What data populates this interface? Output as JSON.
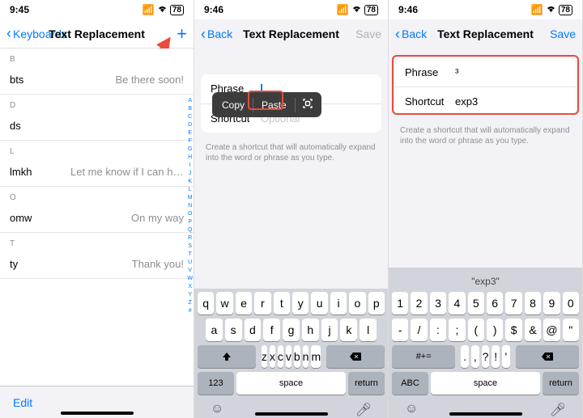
{
  "p1": {
    "time": "9:45",
    "battery": "78",
    "back": "Keyboards",
    "title": "Text Replacement",
    "edit": "Edit",
    "sections": [
      {
        "hdr": "B",
        "rows": [
          {
            "k": "bts",
            "v": "Be there soon!"
          }
        ]
      },
      {
        "hdr": "D",
        "rows": [
          {
            "k": "ds",
            "v": ""
          }
        ]
      },
      {
        "hdr": "L",
        "rows": [
          {
            "k": "lmkh",
            "v": "Let me know if I can help"
          }
        ]
      },
      {
        "hdr": "O",
        "rows": [
          {
            "k": "omw",
            "v": "On my way"
          }
        ]
      },
      {
        "hdr": "T",
        "rows": [
          {
            "k": "ty",
            "v": "Thank you!"
          }
        ]
      }
    ],
    "index": [
      "A",
      "B",
      "C",
      "D",
      "E",
      "F",
      "G",
      "H",
      "I",
      "J",
      "K",
      "L",
      "M",
      "N",
      "O",
      "P",
      "Q",
      "R",
      "S",
      "T",
      "U",
      "V",
      "W",
      "X",
      "Y",
      "Z",
      "#"
    ]
  },
  "p2": {
    "time": "9:46",
    "back": "Back",
    "title": "Text Replacement",
    "save": "Save",
    "menu": {
      "copy": "Copy",
      "paste": "Paste"
    },
    "phrase_lbl": "Phrase",
    "phrase_val": "",
    "shortcut_lbl": "Shortcut",
    "shortcut_ph": "Optional",
    "help": "Create a shortcut that will automatically expand into the word or phrase as you type.",
    "kb": {
      "r1": [
        "q",
        "w",
        "e",
        "r",
        "t",
        "y",
        "u",
        "i",
        "o",
        "p"
      ],
      "r2": [
        "a",
        "s",
        "d",
        "f",
        "g",
        "h",
        "j",
        "k",
        "l"
      ],
      "r3": [
        "z",
        "x",
        "c",
        "v",
        "b",
        "n",
        "m"
      ],
      "n123": "123",
      "space": "space",
      "ret": "return"
    }
  },
  "p3": {
    "time": "9:46",
    "back": "Back",
    "title": "Text Replacement",
    "save": "Save",
    "phrase_lbl": "Phrase",
    "phrase_val": "³",
    "shortcut_lbl": "Shortcut",
    "shortcut_val": "exp3",
    "help": "Create a shortcut that will automatically expand into the word or phrase as you type.",
    "sugg": "\"exp3\"",
    "kb": {
      "r1": [
        "1",
        "2",
        "3",
        "4",
        "5",
        "6",
        "7",
        "8",
        "9",
        "0"
      ],
      "r2": [
        "-",
        "/",
        ":",
        ";",
        "(",
        ")",
        "$",
        "&",
        "@",
        "\""
      ],
      "r3": [
        ".",
        ",",
        "?",
        "!",
        "'"
      ],
      "sym": "#+=",
      "abc": "ABC",
      "space": "space",
      "ret": "return"
    }
  }
}
